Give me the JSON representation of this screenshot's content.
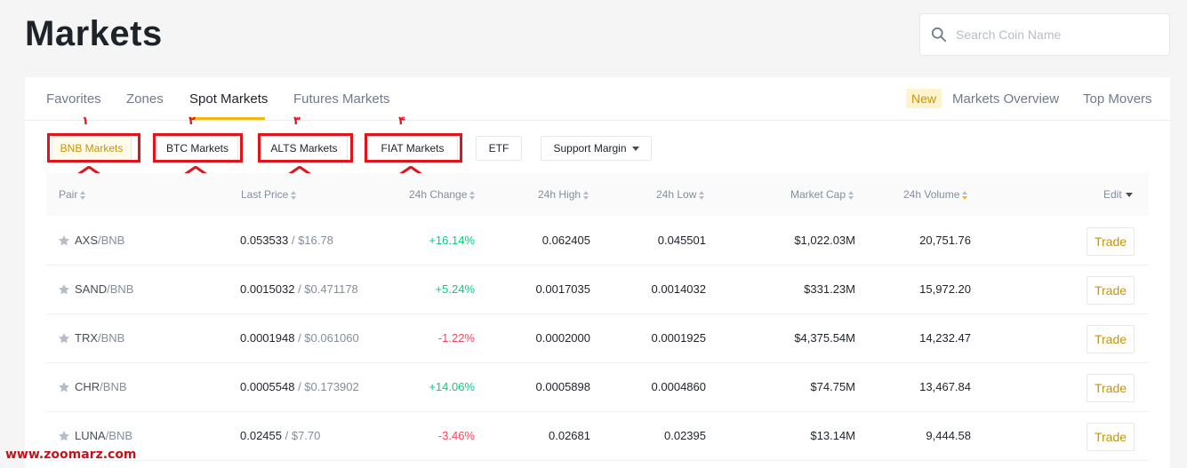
{
  "header": {
    "title": "Markets",
    "search_placeholder": "Search Coin Name"
  },
  "tabs": [
    {
      "label": "Favorites"
    },
    {
      "label": "Zones"
    },
    {
      "label": "Spot Markets"
    },
    {
      "label": "Futures Markets"
    }
  ],
  "right_tabs": {
    "new_badge": "New",
    "markets_overview": "Markets Overview",
    "top_movers": "Top Movers"
  },
  "market_buttons": [
    {
      "label": "BNB Markets"
    },
    {
      "label": "BTC Markets"
    },
    {
      "label": "ALTS Markets"
    },
    {
      "label": "FIAT Markets"
    },
    {
      "label": "ETF"
    },
    {
      "label": "Support Margin"
    }
  ],
  "annotation_numbers": [
    "١",
    "٢",
    "٣",
    "۴"
  ],
  "columns": {
    "pair": "Pair",
    "last_price": "Last Price",
    "change": "24h Change",
    "high": "24h High",
    "low": "24h Low",
    "market_cap": "Market Cap",
    "volume": "24h Volume",
    "edit": "Edit"
  },
  "rows": [
    {
      "base": "AXS",
      "quote": "/BNB",
      "price": "0.053533",
      "usd": " / $16.78",
      "change": "+16.14%",
      "high": "0.062405",
      "low": "0.045501",
      "cap": "$1,022.03M",
      "volume": "20,751.76",
      "trade": "Trade"
    },
    {
      "base": "SAND",
      "quote": "/BNB",
      "price": "0.0015032",
      "usd": " / $0.471178",
      "change": "+5.24%",
      "high": "0.0017035",
      "low": "0.0014032",
      "cap": "$331.23M",
      "volume": "15,972.20",
      "trade": "Trade"
    },
    {
      "base": "TRX",
      "quote": "/BNB",
      "price": "0.0001948",
      "usd": " / $0.061060",
      "change": "-1.22%",
      "high": "0.0002000",
      "low": "0.0001925",
      "cap": "$4,375.54M",
      "volume": "14,232.47",
      "trade": "Trade"
    },
    {
      "base": "CHR",
      "quote": "/BNB",
      "price": "0.0005548",
      "usd": " / $0.173902",
      "change": "+14.06%",
      "high": "0.0005898",
      "low": "0.0004860",
      "cap": "$74.75M",
      "volume": "13,467.84",
      "trade": "Trade"
    },
    {
      "base": "LUNA",
      "quote": "/BNB",
      "price": "0.02455",
      "usd": " / $7.70",
      "change": "-3.46%",
      "high": "0.02681",
      "low": "0.02395",
      "cap": "$13.14M",
      "volume": "9,444.58",
      "trade": "Trade"
    }
  ],
  "colors": {
    "accent": "#f0b90b",
    "positive": "#0ecb81",
    "negative": "#f6465d",
    "annotation": "#e0141b"
  },
  "watermark": "www.zoomarz.com"
}
